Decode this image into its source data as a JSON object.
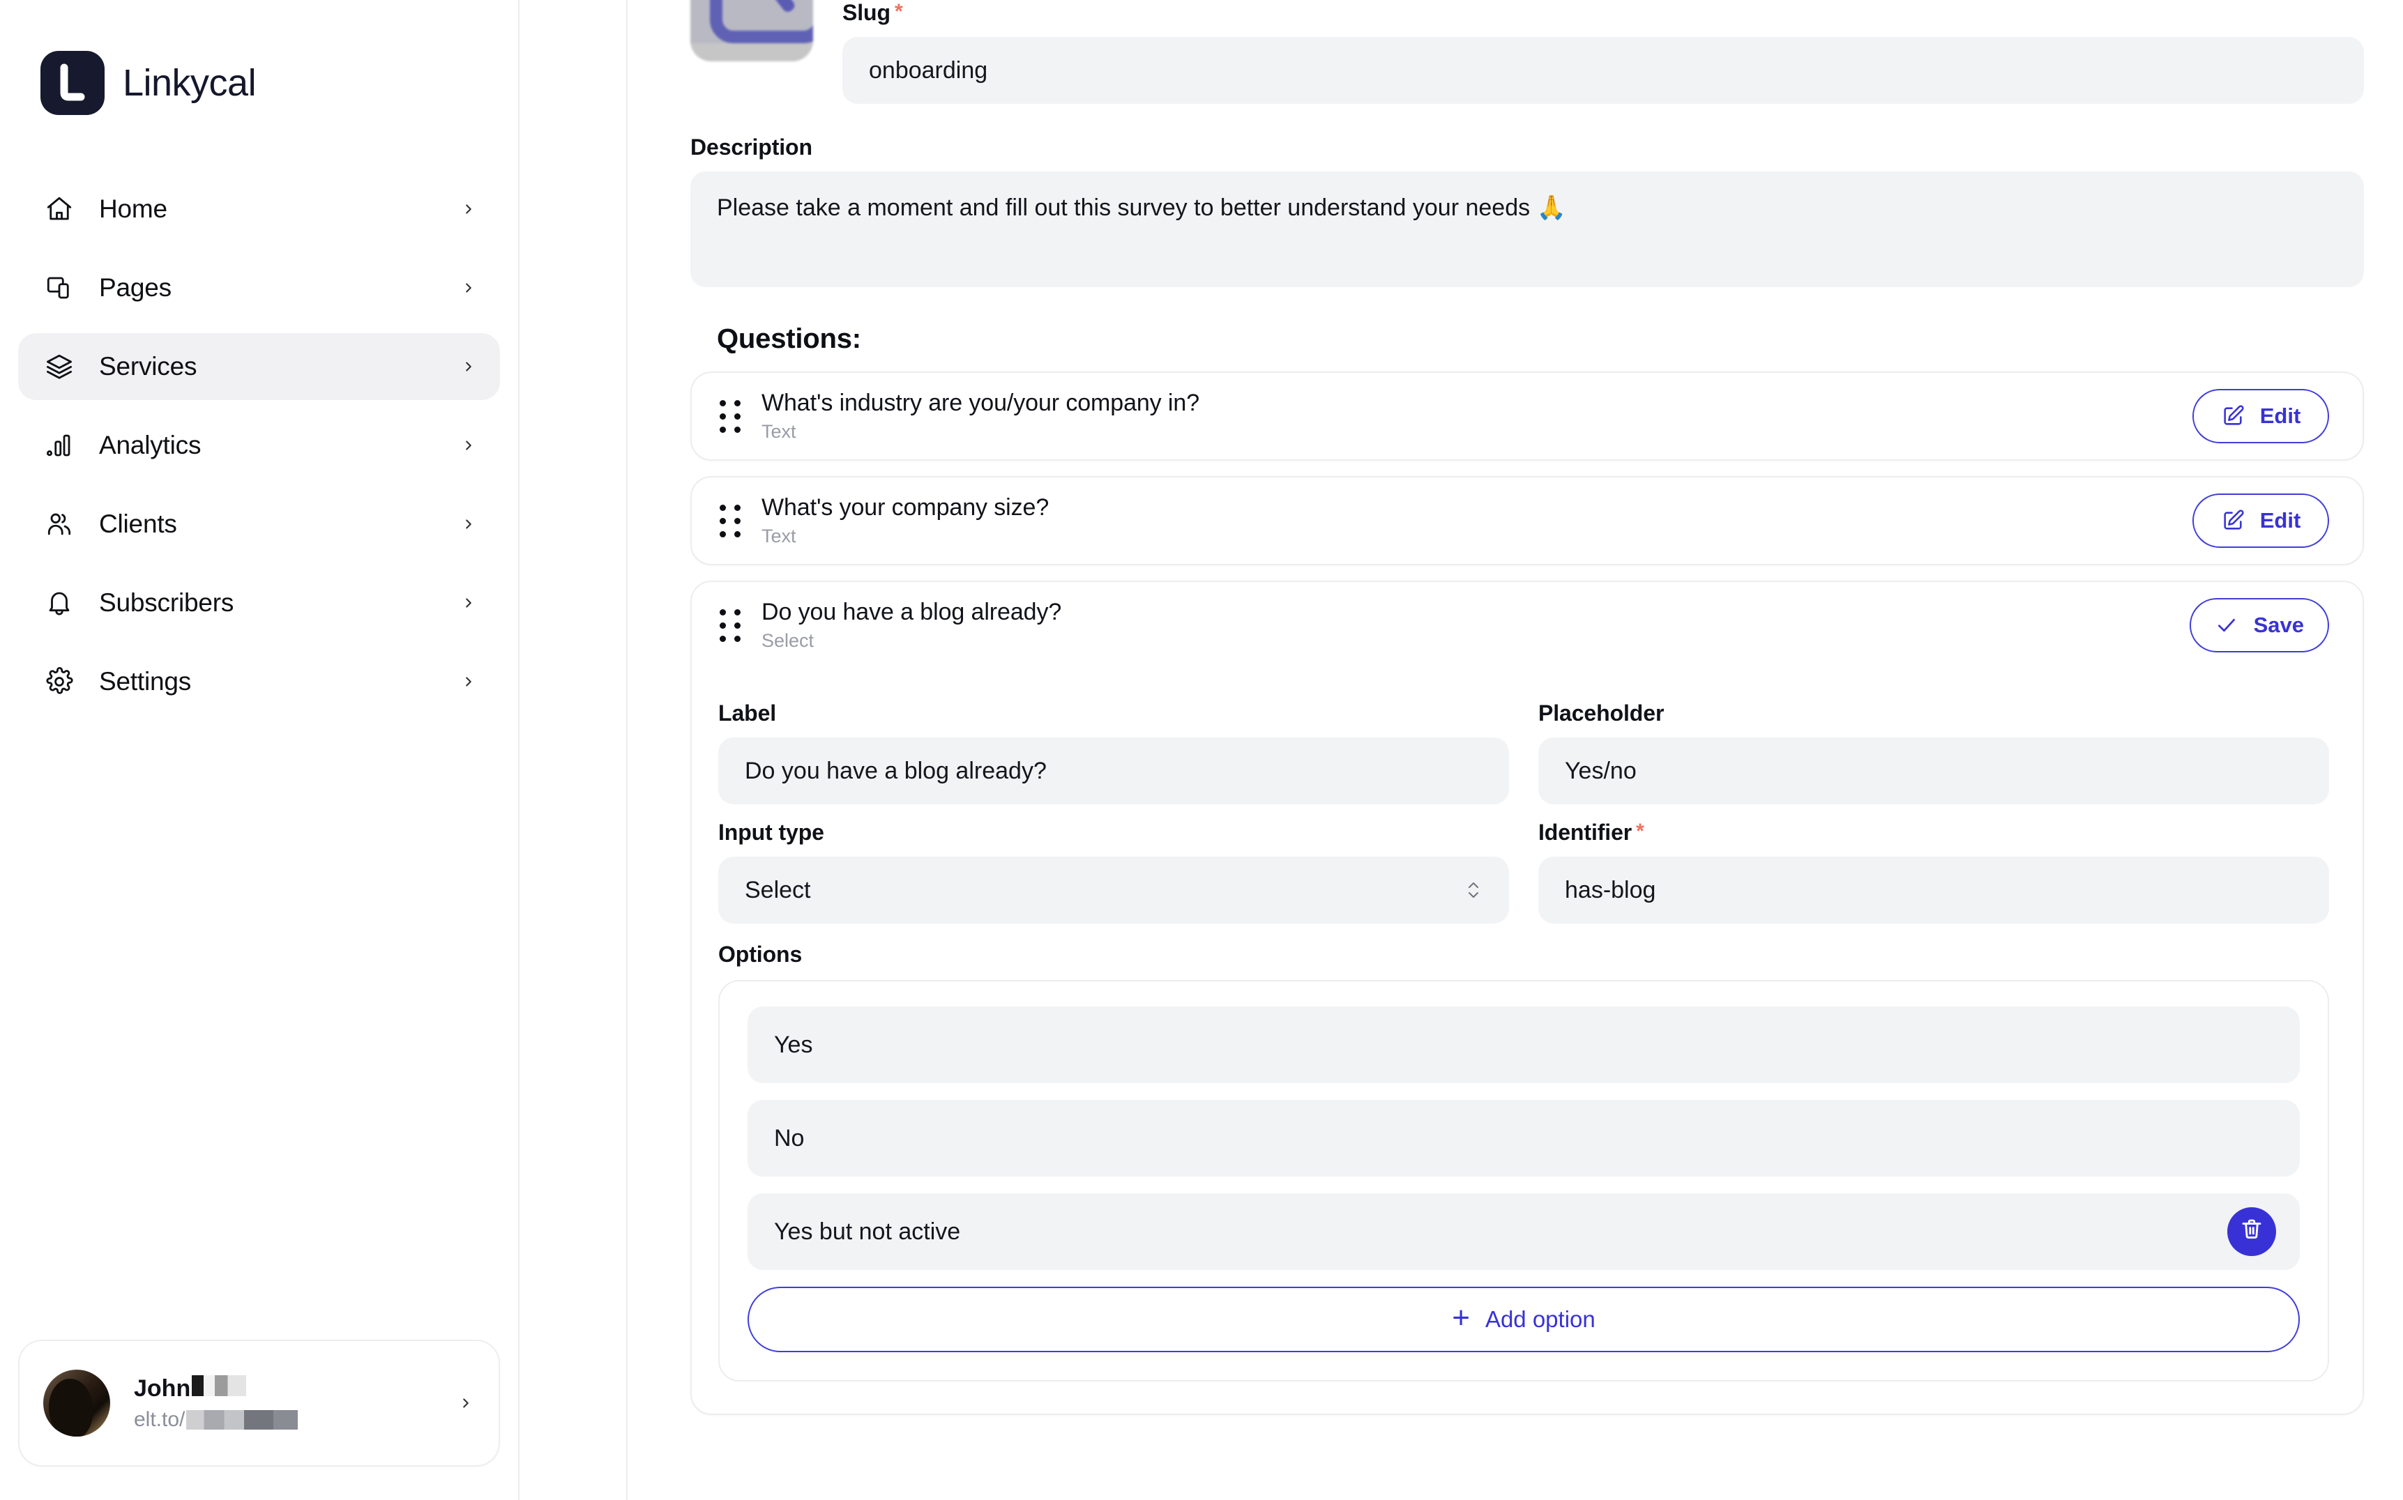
{
  "brand": {
    "name": "Linkycal"
  },
  "sidebar": {
    "items": [
      {
        "label": "Home",
        "icon": "home-icon"
      },
      {
        "label": "Pages",
        "icon": "pages-icon"
      },
      {
        "label": "Services",
        "icon": "layers-icon",
        "active": true
      },
      {
        "label": "Analytics",
        "icon": "bar-chart-icon"
      },
      {
        "label": "Clients",
        "icon": "users-icon"
      },
      {
        "label": "Subscribers",
        "icon": "bell-icon"
      },
      {
        "label": "Settings",
        "icon": "gear-icon"
      }
    ],
    "user": {
      "name": "John",
      "name_redacted": true,
      "url_prefix": "elt.to/",
      "url_redacted": true
    }
  },
  "main": {
    "slug": {
      "label": "Slug",
      "required": true,
      "value": "onboarding"
    },
    "description": {
      "label": "Description",
      "value": "Please take a moment and fill out this survey to better understand your needs 🙏"
    },
    "questions_heading": "Questions:",
    "questions": [
      {
        "title": "What's industry are you/your company in?",
        "type": "Text",
        "action": "Edit",
        "action_icon": "pencil-edit-icon",
        "expanded": false
      },
      {
        "title": "What's your company size?",
        "type": "Text",
        "action": "Edit",
        "action_icon": "pencil-edit-icon",
        "expanded": false
      },
      {
        "title": "Do you have a blog already?",
        "type": "Select",
        "action": "Save",
        "action_icon": "check-icon",
        "expanded": true,
        "editor": {
          "label_field": {
            "label": "Label",
            "value": "Do you have a blog already?"
          },
          "placeholder_field": {
            "label": "Placeholder",
            "value": "Yes/no"
          },
          "input_type_field": {
            "label": "Input type",
            "value": "Select"
          },
          "identifier_field": {
            "label": "Identifier",
            "required": true,
            "value": "has-blog"
          },
          "options_label": "Options",
          "options": [
            {
              "value": "Yes",
              "deletable": false
            },
            {
              "value": "No",
              "deletable": false
            },
            {
              "value": "Yes but not active",
              "deletable": true
            }
          ],
          "add_option_label": "Add option"
        }
      }
    ]
  },
  "colors": {
    "accent": "#3832d6",
    "required": "#f0715f",
    "field_bg": "#f2f3f5",
    "border": "#ededf0",
    "sidebar_active": "#f1f1f3"
  }
}
